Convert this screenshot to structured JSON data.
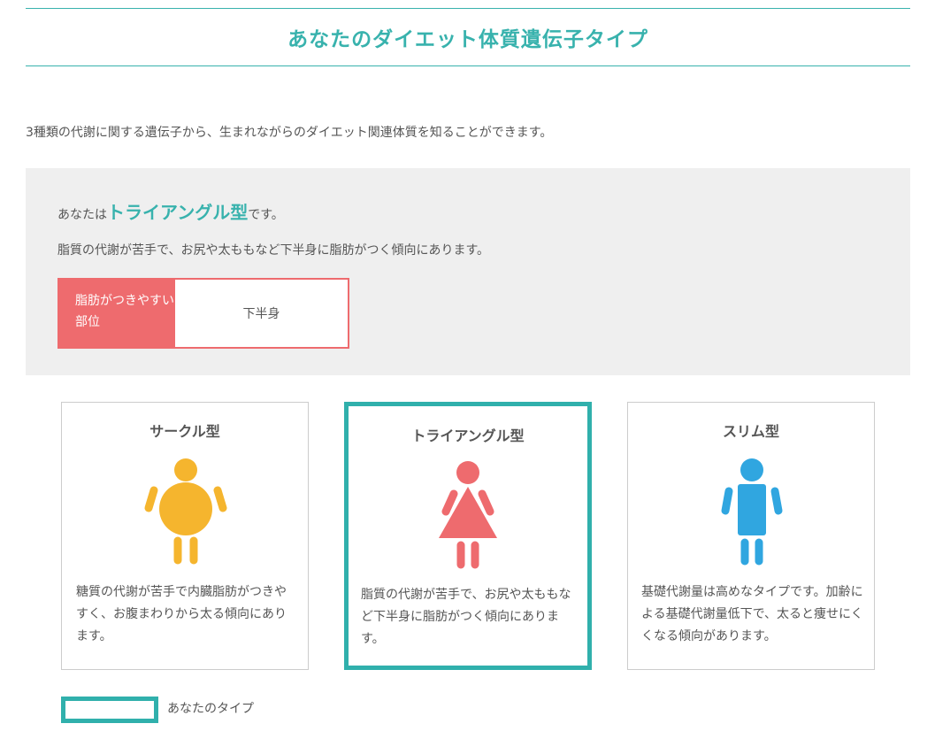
{
  "header": {
    "title": "あなたのダイエット体質遺伝子タイプ"
  },
  "intro": "3種類の代謝に関する遺伝子から、生まれながらのダイエット関連体質を知ることができます。",
  "result": {
    "prefix": "あなたは",
    "type_name": "トライアングル型",
    "suffix": "です。",
    "description": "脂質の代謝が苦手で、お尻や太ももなど下半身に脂肪がつく傾向にあります。",
    "fat_area_label": "脂肪がつきやすい部位",
    "fat_area_value": "下半身"
  },
  "cards": [
    {
      "title": "サークル型",
      "text": "糖質の代謝が苦手で内臓脂肪がつきやすく、お腹まわりから太る傾向にあります。",
      "color": "#f5b52e",
      "icon": "circle-body-icon",
      "selected": false
    },
    {
      "title": "トライアングル型",
      "text": "脂質の代謝が苦手で、お尻や太ももなど下半身に脂肪がつく傾向にあります。",
      "color": "#ee6b6e",
      "icon": "triangle-body-icon",
      "selected": true
    },
    {
      "title": "スリム型",
      "text": "基礎代謝量は高めなタイプです。加齢による基礎代謝量低下で、太ると痩せにくくなる傾向があります。",
      "color": "#30a6e0",
      "icon": "slim-body-icon",
      "selected": false
    }
  ],
  "legend": {
    "label": "あなたのタイプ"
  },
  "colors": {
    "accent": "#38b2ad",
    "highlight_border": "#30b0ac",
    "fat_label_bg": "#ee6b6e",
    "panel_bg": "#efefef"
  }
}
